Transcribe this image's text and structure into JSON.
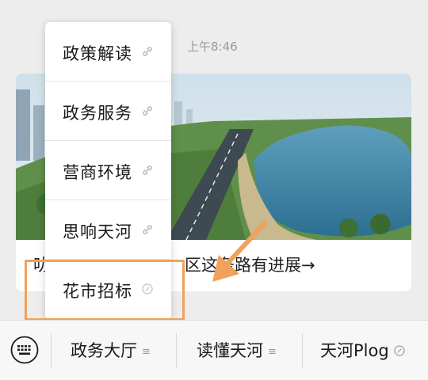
{
  "chat": {
    "timestamp": "上午8:46"
  },
  "article_card": {
    "title": "叻...区这条路有进展→",
    "title_left": "叻",
    "title_right": "区这条路有进展→"
  },
  "popup_menu": {
    "items": [
      {
        "label": "政策解读",
        "icon": "link-icon"
      },
      {
        "label": "政务服务",
        "icon": "link-icon"
      },
      {
        "label": "营商环境",
        "icon": "link-icon"
      },
      {
        "label": "思响天河",
        "icon": "link-icon"
      },
      {
        "label": "花市招标",
        "icon": "link-icon"
      }
    ]
  },
  "annotation": {
    "highlight_color": "#f0a15a"
  },
  "bottom_menu": {
    "keyboard_icon": "keyboard-icon",
    "tabs": [
      {
        "label": "政务大厅",
        "icon": "menu-lines-icon"
      },
      {
        "label": "读懂天河",
        "icon": "menu-lines-icon"
      },
      {
        "label": "天河Plog",
        "icon": "link-icon"
      }
    ]
  }
}
